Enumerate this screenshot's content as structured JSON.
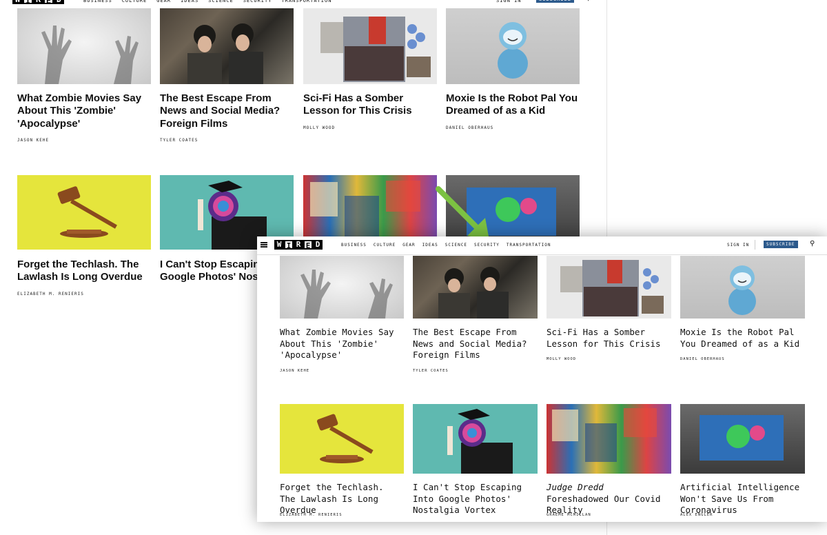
{
  "site": {
    "logo_letters": [
      "W",
      "I",
      "R",
      "E",
      "D"
    ],
    "nav": [
      "BUSINESS",
      "CULTURE",
      "GEAR",
      "IDEAS",
      "SCIENCE",
      "SECURITY",
      "TRANSPORTATION"
    ],
    "sign_in": "SIGN IN",
    "subscribe": "SUBSCRIBE",
    "accent_color": "#2c5a8c",
    "arrow_color": "#7cc242"
  },
  "articles": [
    {
      "title": "What Zombie Movies Say About This 'Zombie' 'Apocalypse'",
      "author": "JASON KEHE",
      "image": "zombie-hands"
    },
    {
      "title": "The Best Escape From News and Social Media? Foreign Films",
      "author": "TYLER COATES",
      "image": "parasite-still"
    },
    {
      "title": "Sci-Fi Has a Somber Lesson for This Crisis",
      "author": "MOLLY WOOD",
      "image": "scifi-collage"
    },
    {
      "title": "Moxie Is the Robot Pal You Dreamed of as a Kid",
      "author": "DANIEL OBERHAUS",
      "image": "moxie-robot"
    },
    {
      "title": "Forget the Techlash. The Lawlash Is Long Overdue",
      "author": "ELIZABETH M. RENIERIS",
      "image": "gavel"
    },
    {
      "title": "I Can't Stop Escaping Into Google Photos' Nostalgia Vortex",
      "author": "",
      "image": "graduate-swirl"
    },
    {
      "title_em": "Judge Dredd",
      "title_rest": " Foreshadowed Our Covid Reality",
      "author": "GRAEME MCMILLAN",
      "image": "comics-collage"
    },
    {
      "title": "Artificial Intelligence Won't Save Us From Coronavirus",
      "author": "ALEX ENGLER",
      "image": "ai-screen"
    }
  ],
  "back_partial": {
    "grad_title": "I Can't Stop Escaping Google Photos' Nost Vortex"
  }
}
